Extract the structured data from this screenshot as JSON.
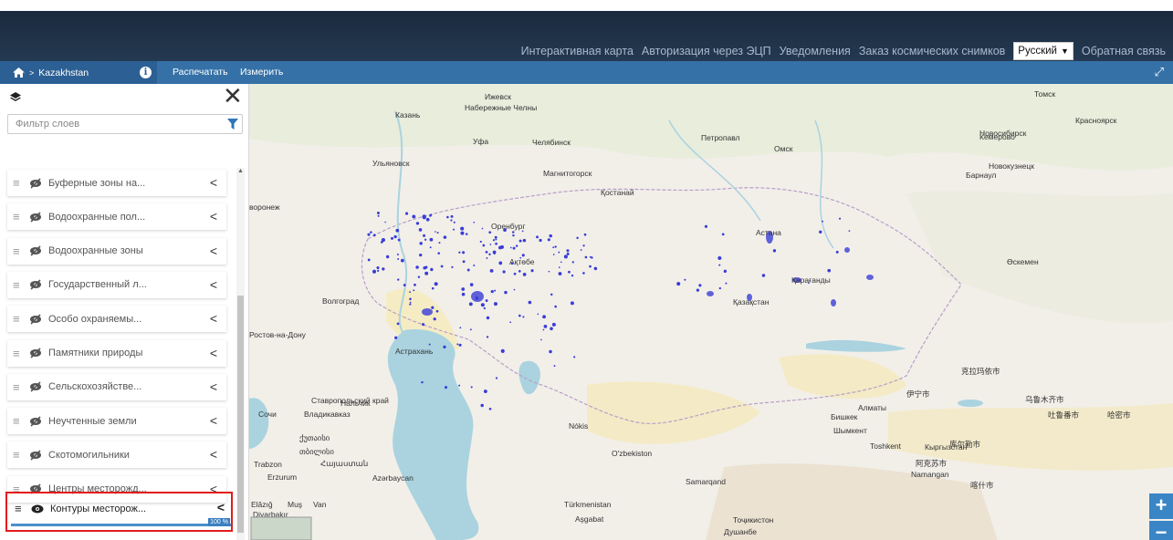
{
  "header": {
    "nav": [
      "Интерактивная карта",
      "Авторизация через ЭЦП",
      "Уведомления",
      "Заказ космических снимков"
    ],
    "language": "Русский",
    "feedback": "Обратная связь"
  },
  "toolbar": {
    "breadcrumb": "Kazakhstan",
    "print": "Распечатать",
    "measure": "Измерить"
  },
  "panel": {
    "filter_placeholder": "Фильтр слоев",
    "layers": [
      {
        "label": "Буферные зоны на...",
        "visible": false
      },
      {
        "label": "Водоохранные пол...",
        "visible": false
      },
      {
        "label": "Водоохранные зоны",
        "visible": false
      },
      {
        "label": "Государственный л...",
        "visible": false
      },
      {
        "label": "Особо охраняемы...",
        "visible": false
      },
      {
        "label": "Памятники природы",
        "visible": false
      },
      {
        "label": "Сельскохозяйстве...",
        "visible": false
      },
      {
        "label": "Неучтенные земли",
        "visible": false
      },
      {
        "label": "Скотомогильники",
        "visible": false
      },
      {
        "label": "Центры месторожд...",
        "visible": false
      }
    ],
    "active_layer": {
      "label": "Контуры месторож...",
      "visible": true,
      "progress": "100 %"
    }
  },
  "map": {
    "labels": [
      {
        "t": "Ижевск"
      },
      {
        "t": "Набережные Челны"
      },
      {
        "t": "Казань"
      },
      {
        "t": "Уфа"
      },
      {
        "t": "Челябинск"
      },
      {
        "t": "Петропавл"
      },
      {
        "t": "Омск"
      },
      {
        "t": "Томск"
      },
      {
        "t": "Красноярск"
      },
      {
        "t": "Новосибирск"
      },
      {
        "t": "Кемерово"
      },
      {
        "t": "Новокузнецк"
      },
      {
        "t": "Барнаул"
      },
      {
        "t": "Ульяновск"
      },
      {
        "t": "Магнитогорск"
      },
      {
        "t": "Қостанай"
      },
      {
        "t": "Оренбург"
      },
      {
        "t": "Астана"
      },
      {
        "t": "Өскемен"
      },
      {
        "t": "Ақтөбе"
      },
      {
        "t": "Қарағанды"
      },
      {
        "t": "Қазақстан"
      },
      {
        "t": "Волгоград"
      },
      {
        "t": "Ростов-на-Дону"
      },
      {
        "t": "Астрахань"
      },
      {
        "t": "Нальчик"
      },
      {
        "t": "Владикавказ"
      },
      {
        "t": "Сочи"
      },
      {
        "t": "Nókis"
      },
      {
        "t": "Алматы"
      },
      {
        "t": "Бишкек"
      },
      {
        "t": "Шымкент"
      },
      {
        "t": "Toshkent"
      },
      {
        "t": "O'zbekiston"
      },
      {
        "t": "Кыргызстан"
      },
      {
        "t": "Namangan"
      },
      {
        "t": "Samarqand"
      },
      {
        "t": "Тоҷикистон"
      },
      {
        "t": "Душанбе"
      },
      {
        "t": "Türkmenistan"
      },
      {
        "t": "Aşgabat"
      },
      {
        "t": "Erzurum"
      },
      {
        "t": "Trabzon"
      },
      {
        "t": "Azərbaycan"
      },
      {
        "t": "Diyarbakır"
      },
      {
        "t": "Elâzığ"
      },
      {
        "t": "Muş"
      },
      {
        "t": "Van"
      },
      {
        "t": "克拉玛依市"
      },
      {
        "t": "乌鲁木齐市"
      },
      {
        "t": "吐鲁番市"
      },
      {
        "t": "哈密市"
      },
      {
        "t": "库尔勒市"
      },
      {
        "t": "阿克苏市"
      },
      {
        "t": "喀什市"
      },
      {
        "t": "伊宁市"
      },
      {
        "t": "ქუთაისი"
      },
      {
        "t": "თბილისი"
      },
      {
        "t": "Հայաստան"
      },
      {
        "t": "воронеж"
      },
      {
        "t": "Ставропольский край"
      }
    ]
  },
  "colors": {
    "header": "#1f3247",
    "toolbar": "#3571a6",
    "accent": "#3a85c6",
    "highlight": "#e21c1c",
    "polygons": "#3a3dd6"
  }
}
